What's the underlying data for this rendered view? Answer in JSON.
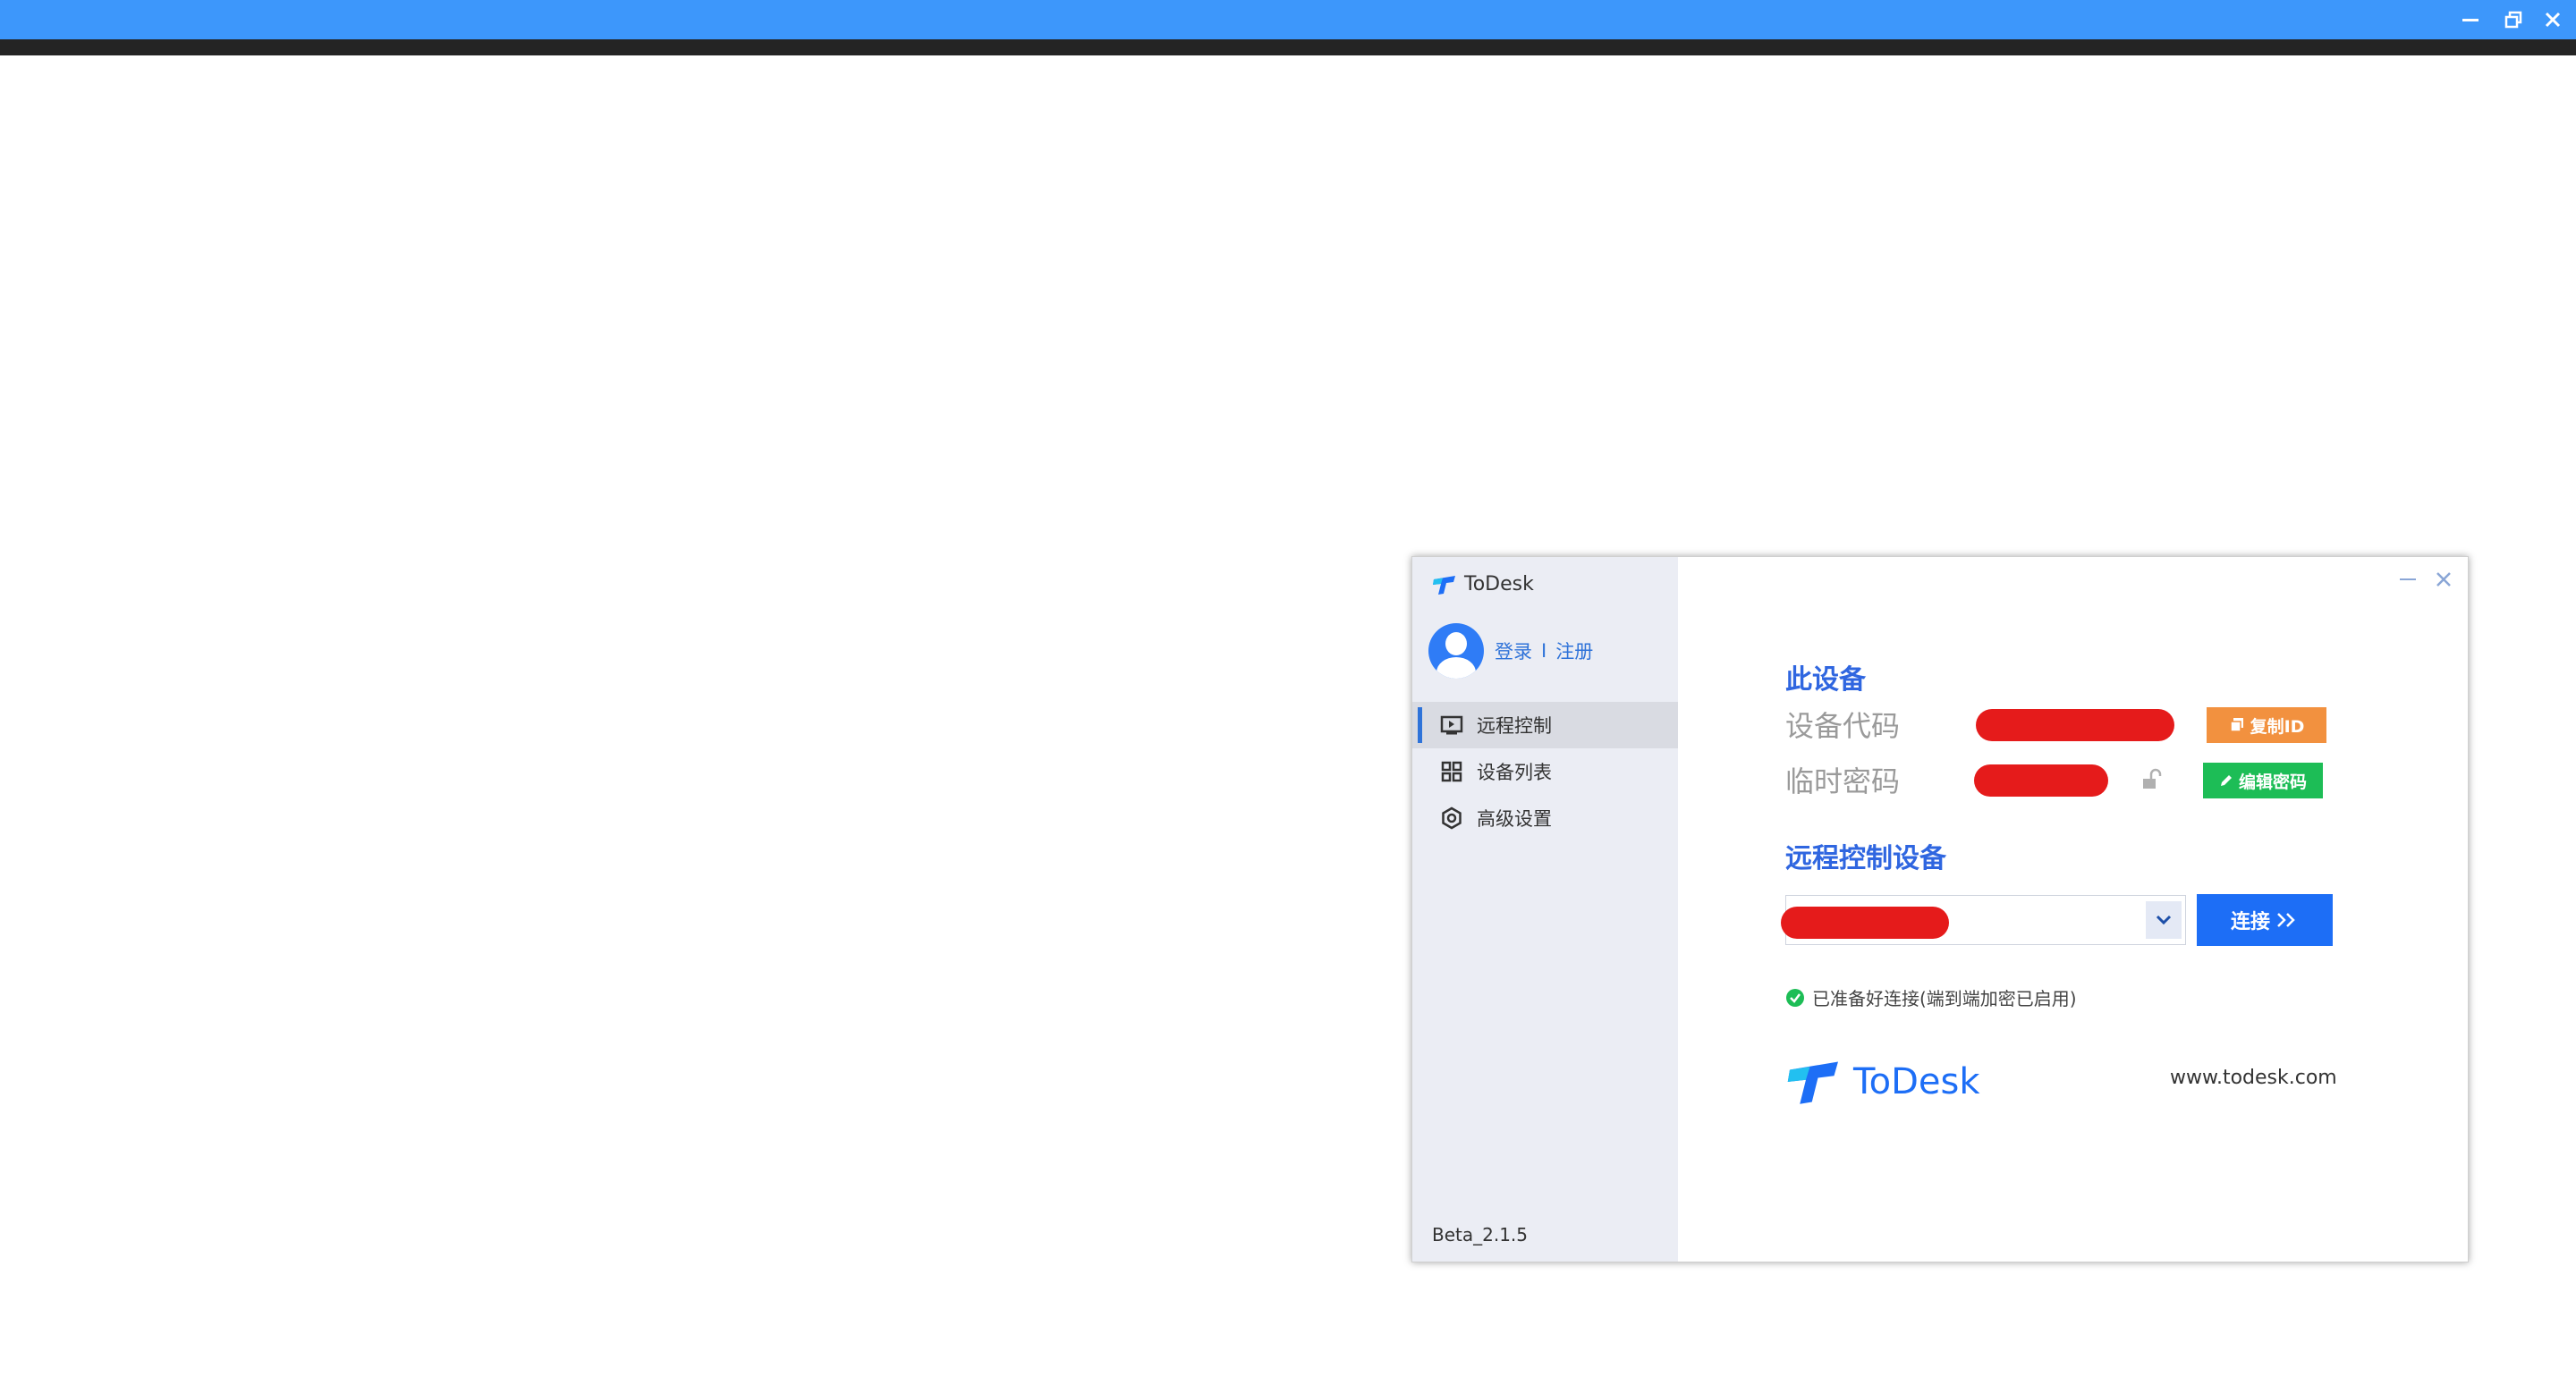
{
  "outer_window": {
    "minimize_icon": "minimize-icon",
    "restore_icon": "restore-icon",
    "close_icon": "close-icon"
  },
  "app": {
    "name": "ToDesk",
    "version": "Beta_2.1.5",
    "website": "www.todesk.com"
  },
  "account": {
    "login": "登录",
    "separator": "I",
    "register": "注册"
  },
  "sidebar": {
    "items": [
      {
        "label": "远程控制",
        "icon": "remote-screen-icon",
        "active": true
      },
      {
        "label": "设备列表",
        "icon": "grid-icon",
        "active": false
      },
      {
        "label": "高级设置",
        "icon": "gear-icon",
        "active": false
      }
    ]
  },
  "this_device": {
    "title": "此设备",
    "device_code_label": "设备代码",
    "temp_password_label": "临时密码",
    "copy_id_label": "复制ID",
    "edit_password_label": "编辑密码"
  },
  "remote": {
    "title": "远程控制设备",
    "connect_label": "连接",
    "status_text": "已准备好连接(端到端加密已启用)"
  },
  "colors": {
    "titlebar": "#3d97fb",
    "accent": "#1d6ef6",
    "orange": "#f2913f",
    "green": "#1dbd56",
    "redaction": "#e51b1b"
  }
}
